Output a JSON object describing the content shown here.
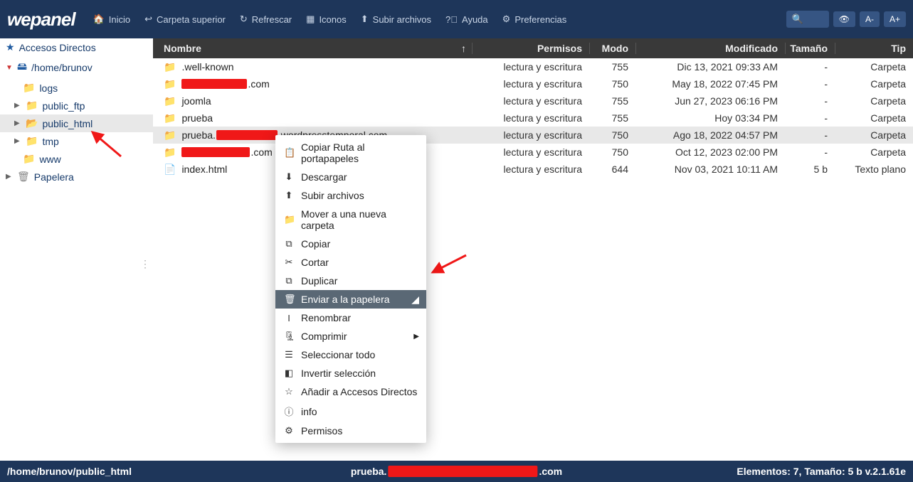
{
  "brand": "wepanel",
  "nav": {
    "home": "Inicio",
    "parent": "Carpeta superior",
    "refresh": "Refrescar",
    "icons": "Iconos",
    "upload": "Subir archivos",
    "help": "Ayuda",
    "prefs": "Preferencias"
  },
  "topbar_buttons": {
    "a_minus": "A-",
    "a_plus": "A+"
  },
  "sidebar": {
    "shortcuts": "Accesos Directos",
    "home_path": "/home/brunov",
    "items": {
      "logs": "logs",
      "public_ftp": "public_ftp",
      "public_html": "public_html",
      "tmp": "tmp",
      "www": "www"
    },
    "trash": "Papelera"
  },
  "columns": {
    "name": "Nombre",
    "perms": "Permisos",
    "mode": "Modo",
    "modified": "Modificado",
    "size": "Tamaño",
    "type": "Tip"
  },
  "rows": [
    {
      "name": ".well-known",
      "perms": "lectura y escritura",
      "mode": "755",
      "mod": "Dic 13, 2021 09:33 AM",
      "size": "-",
      "type": "Carpeta",
      "kind": "folder"
    },
    {
      "name_suffix": ".com",
      "redact_w": 92,
      "perms": "lectura y escritura",
      "mode": "750",
      "mod": "May 18, 2022 07:45 PM",
      "size": "-",
      "type": "Carpeta",
      "kind": "folder"
    },
    {
      "name": "joomla",
      "perms": "lectura y escritura",
      "mode": "755",
      "mod": "Jun 27, 2023 06:16 PM",
      "size": "-",
      "type": "Carpeta",
      "kind": "folder"
    },
    {
      "name": "prueba",
      "perms": "lectura y escritura",
      "mode": "755",
      "mod": "Hoy 03:34 PM",
      "size": "-",
      "type": "Carpeta",
      "kind": "folder"
    },
    {
      "name_prefix": "prueba.",
      "name_suffix": ".wordpresstemporal.com",
      "redact_w": 86,
      "perms": "lectura y escritura",
      "mode": "750",
      "mod": "Ago 18, 2022 04:57 PM",
      "size": "-",
      "type": "Carpeta",
      "kind": "folder",
      "selected": true
    },
    {
      "name_suffix": ".com",
      "redact_w": 96,
      "perms": "lectura y escritura",
      "mode": "750",
      "mod": "Oct 12, 2023 02:00 PM",
      "size": "-",
      "type": "Carpeta",
      "kind": "folder"
    },
    {
      "name": "index.html",
      "perms": "lectura y escritura",
      "mode": "644",
      "mod": "Nov 03, 2021 10:11 AM",
      "size": "5 b",
      "type": "Texto plano",
      "kind": "file"
    }
  ],
  "context_menu": [
    {
      "label": "Copiar Ruta al portapapeles",
      "icon": "📋"
    },
    {
      "label": "Descargar",
      "icon": "⬇"
    },
    {
      "label": "Subir archivos",
      "icon": "⬆"
    },
    {
      "label": "Mover a una nueva carpeta",
      "icon": "📁"
    },
    {
      "label": "Copiar",
      "icon": "⧉"
    },
    {
      "label": "Cortar",
      "icon": "✂"
    },
    {
      "label": "Duplicar",
      "icon": "⧉"
    },
    {
      "label": "Enviar a la papelera",
      "icon": "🗑",
      "highlight": true,
      "extra": "eraser"
    },
    {
      "label": "Renombrar",
      "icon": "I"
    },
    {
      "label": "Comprimir",
      "icon": "🗜",
      "submenu": true
    },
    {
      "label": "Seleccionar todo",
      "icon": "☰"
    },
    {
      "label": "Invertir selección",
      "icon": "◧"
    },
    {
      "label": "Añadir a Accesos Directos",
      "icon": "☆"
    },
    {
      "label": "info",
      "icon": "ⓘ"
    },
    {
      "label": "Permisos",
      "icon": "⚙"
    }
  ],
  "statusbar": {
    "path": "/home/brunov/public_html",
    "current_prefix": "prueba.",
    "current_suffix": ".com",
    "summary": "Elementos: 7, Tamaño: 5 b v.2.1.61e"
  }
}
